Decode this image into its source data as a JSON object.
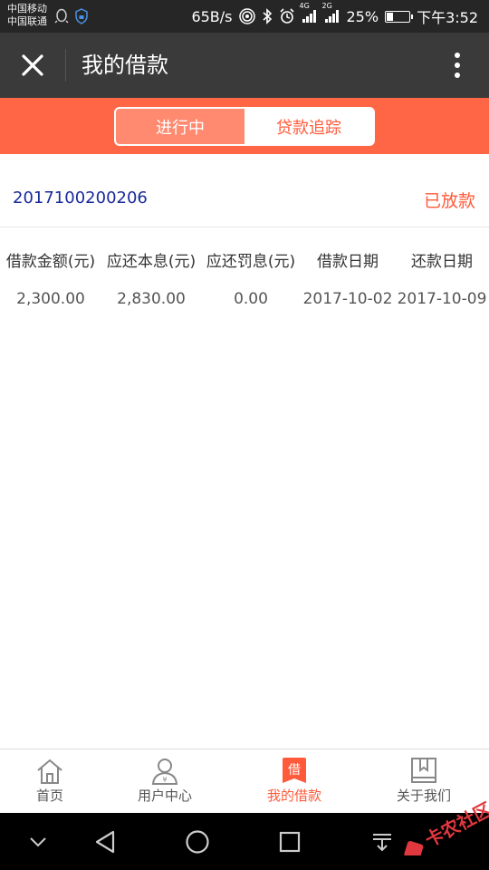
{
  "status_bar": {
    "carrier1": "中国移动",
    "carrier2": "中国联通",
    "speed": "65B/s",
    "net1": "4G",
    "net2": "2G",
    "battery": "25%",
    "battery_level": 0.25,
    "time": "下午3:52"
  },
  "titlebar": {
    "title": "我的借款",
    "close_icon": "close-icon",
    "more_icon": "more-vertical-icon"
  },
  "tabs": [
    {
      "label": "进行中",
      "active": true
    },
    {
      "label": "贷款追踪",
      "active": false
    }
  ],
  "loan": {
    "id": "2017100200206",
    "status": "已放款",
    "columns": [
      "借款金额(元)",
      "应还本息(元)",
      "应还罚息(元)",
      "借款日期",
      "还款日期"
    ],
    "values": [
      "2,300.00",
      "2,830.00",
      "0.00",
      "2017-10-02",
      "2017-10-09"
    ]
  },
  "bottom_nav": [
    {
      "label": "首页",
      "icon": "home-icon",
      "active": false
    },
    {
      "label": "用户中心",
      "icon": "user-icon",
      "active": false
    },
    {
      "label": "我的借款",
      "icon": "borrow-icon",
      "icon_char": "借",
      "active": true
    },
    {
      "label": "关于我们",
      "icon": "book-icon",
      "active": false
    }
  ],
  "watermark": "卡农社区",
  "colors": {
    "accent": "#ff6645",
    "accent_text": "#ff5a3a",
    "titlebar": "#3a3a3a",
    "id_text": "#1a2a9a"
  }
}
